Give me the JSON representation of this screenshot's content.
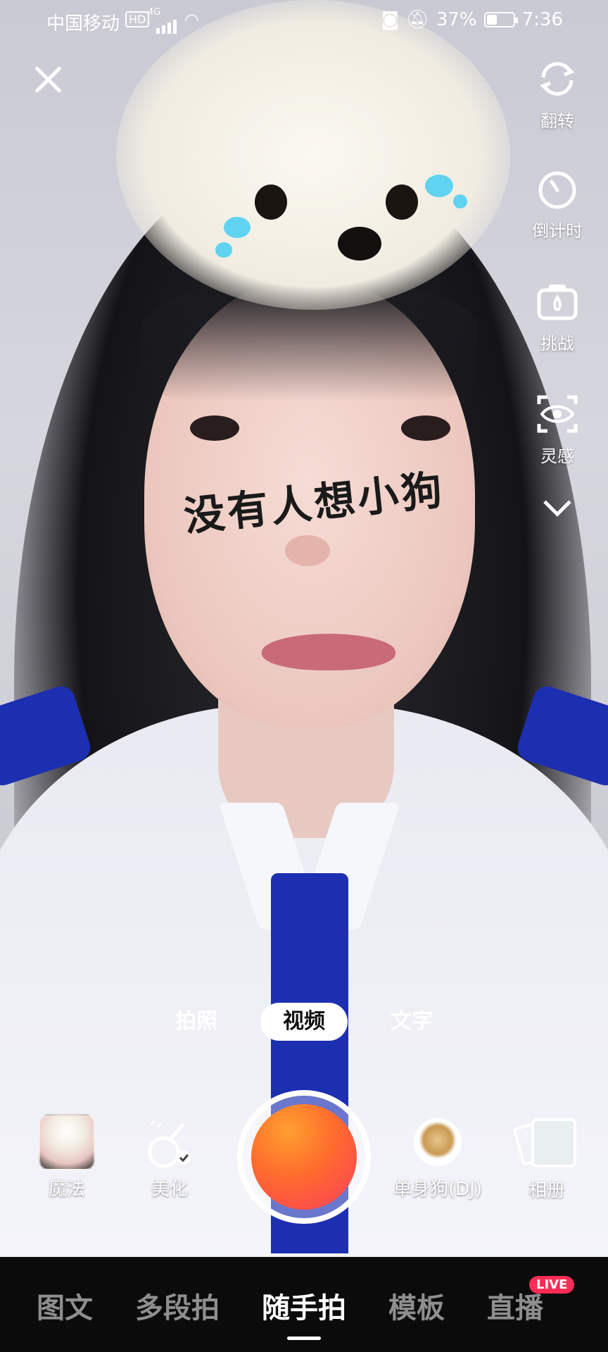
{
  "status_bar": {
    "carrier": "中国移动",
    "hd_badge": "HD",
    "network": "4G",
    "battery_percent": "37%",
    "time": "7:36"
  },
  "sticker": {
    "text": "没有人想小狗"
  },
  "side_tools": [
    {
      "label": "翻转",
      "icon": "flip-camera-icon"
    },
    {
      "label": "倒计时",
      "icon": "timer-icon"
    },
    {
      "label": "挑战",
      "icon": "challenge-camera-icon"
    },
    {
      "label": "灵感",
      "icon": "inspiration-eye-icon"
    }
  ],
  "modes": {
    "photo": "拍照",
    "video": "视频",
    "text": "文字",
    "selected": "视频"
  },
  "controls": {
    "magic": "魔法",
    "beauty": "美化",
    "music": "单身狗(DJ)",
    "album": "相册"
  },
  "nav": {
    "items": [
      "图文",
      "多段拍",
      "随手拍",
      "模板",
      "直播"
    ],
    "active": "随手拍",
    "live_badge": "LIVE"
  },
  "colors": {
    "shutter_gradient": [
      "#ff9f2e",
      "#fa3d5b"
    ],
    "live_badge": "#fe2c55",
    "nav_bg": "#0b0b0b"
  }
}
